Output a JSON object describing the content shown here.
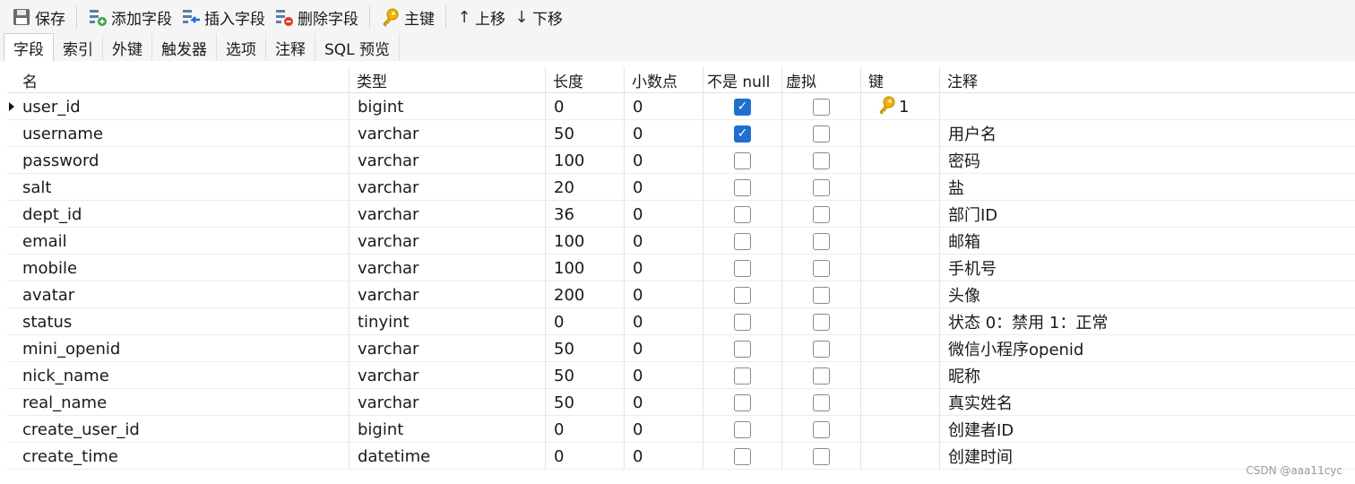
{
  "toolbar": {
    "save": "保存",
    "add_field": "添加字段",
    "insert_field": "插入字段",
    "delete_field": "删除字段",
    "primary_key": "主键",
    "move_up": "上移",
    "move_down": "下移"
  },
  "tabs": [
    "字段",
    "索引",
    "外键",
    "触发器",
    "选项",
    "注释",
    "SQL 预览"
  ],
  "columns": {
    "name": "名",
    "type": "类型",
    "length": "长度",
    "decimals": "小数点",
    "not_null": "不是 null",
    "virtual": "虚拟",
    "key": "键",
    "comment": "注释"
  },
  "rows": [
    {
      "name": "user_id",
      "type": "bigint",
      "length": "0",
      "decimals": "0",
      "not_null": true,
      "virtual": false,
      "key": "1",
      "comment": ""
    },
    {
      "name": "username",
      "type": "varchar",
      "length": "50",
      "decimals": "0",
      "not_null": true,
      "virtual": false,
      "key": "",
      "comment": "用户名"
    },
    {
      "name": "password",
      "type": "varchar",
      "length": "100",
      "decimals": "0",
      "not_null": false,
      "virtual": false,
      "key": "",
      "comment": "密码"
    },
    {
      "name": "salt",
      "type": "varchar",
      "length": "20",
      "decimals": "0",
      "not_null": false,
      "virtual": false,
      "key": "",
      "comment": "盐"
    },
    {
      "name": "dept_id",
      "type": "varchar",
      "length": "36",
      "decimals": "0",
      "not_null": false,
      "virtual": false,
      "key": "",
      "comment": "部门ID"
    },
    {
      "name": "email",
      "type": "varchar",
      "length": "100",
      "decimals": "0",
      "not_null": false,
      "virtual": false,
      "key": "",
      "comment": "邮箱"
    },
    {
      "name": "mobile",
      "type": "varchar",
      "length": "100",
      "decimals": "0",
      "not_null": false,
      "virtual": false,
      "key": "",
      "comment": "手机号"
    },
    {
      "name": "avatar",
      "type": "varchar",
      "length": "200",
      "decimals": "0",
      "not_null": false,
      "virtual": false,
      "key": "",
      "comment": "头像"
    },
    {
      "name": "status",
      "type": "tinyint",
      "length": "0",
      "decimals": "0",
      "not_null": false,
      "virtual": false,
      "key": "",
      "comment": "状态  0：禁用   1：正常"
    },
    {
      "name": "mini_openid",
      "type": "varchar",
      "length": "50",
      "decimals": "0",
      "not_null": false,
      "virtual": false,
      "key": "",
      "comment": "微信小程序openid"
    },
    {
      "name": "nick_name",
      "type": "varchar",
      "length": "50",
      "decimals": "0",
      "not_null": false,
      "virtual": false,
      "key": "",
      "comment": "昵称"
    },
    {
      "name": "real_name",
      "type": "varchar",
      "length": "50",
      "decimals": "0",
      "not_null": false,
      "virtual": false,
      "key": "",
      "comment": "真实姓名"
    },
    {
      "name": "create_user_id",
      "type": "bigint",
      "length": "0",
      "decimals": "0",
      "not_null": false,
      "virtual": false,
      "key": "",
      "comment": "创建者ID"
    },
    {
      "name": "create_time",
      "type": "datetime",
      "length": "0",
      "decimals": "0",
      "not_null": false,
      "virtual": false,
      "key": "",
      "comment": "创建时间"
    }
  ],
  "watermark": "CSDN @aaa11cyc",
  "colors": {
    "checkbox_checked": "#1f6fd1",
    "key_icon": "#f0b400"
  }
}
